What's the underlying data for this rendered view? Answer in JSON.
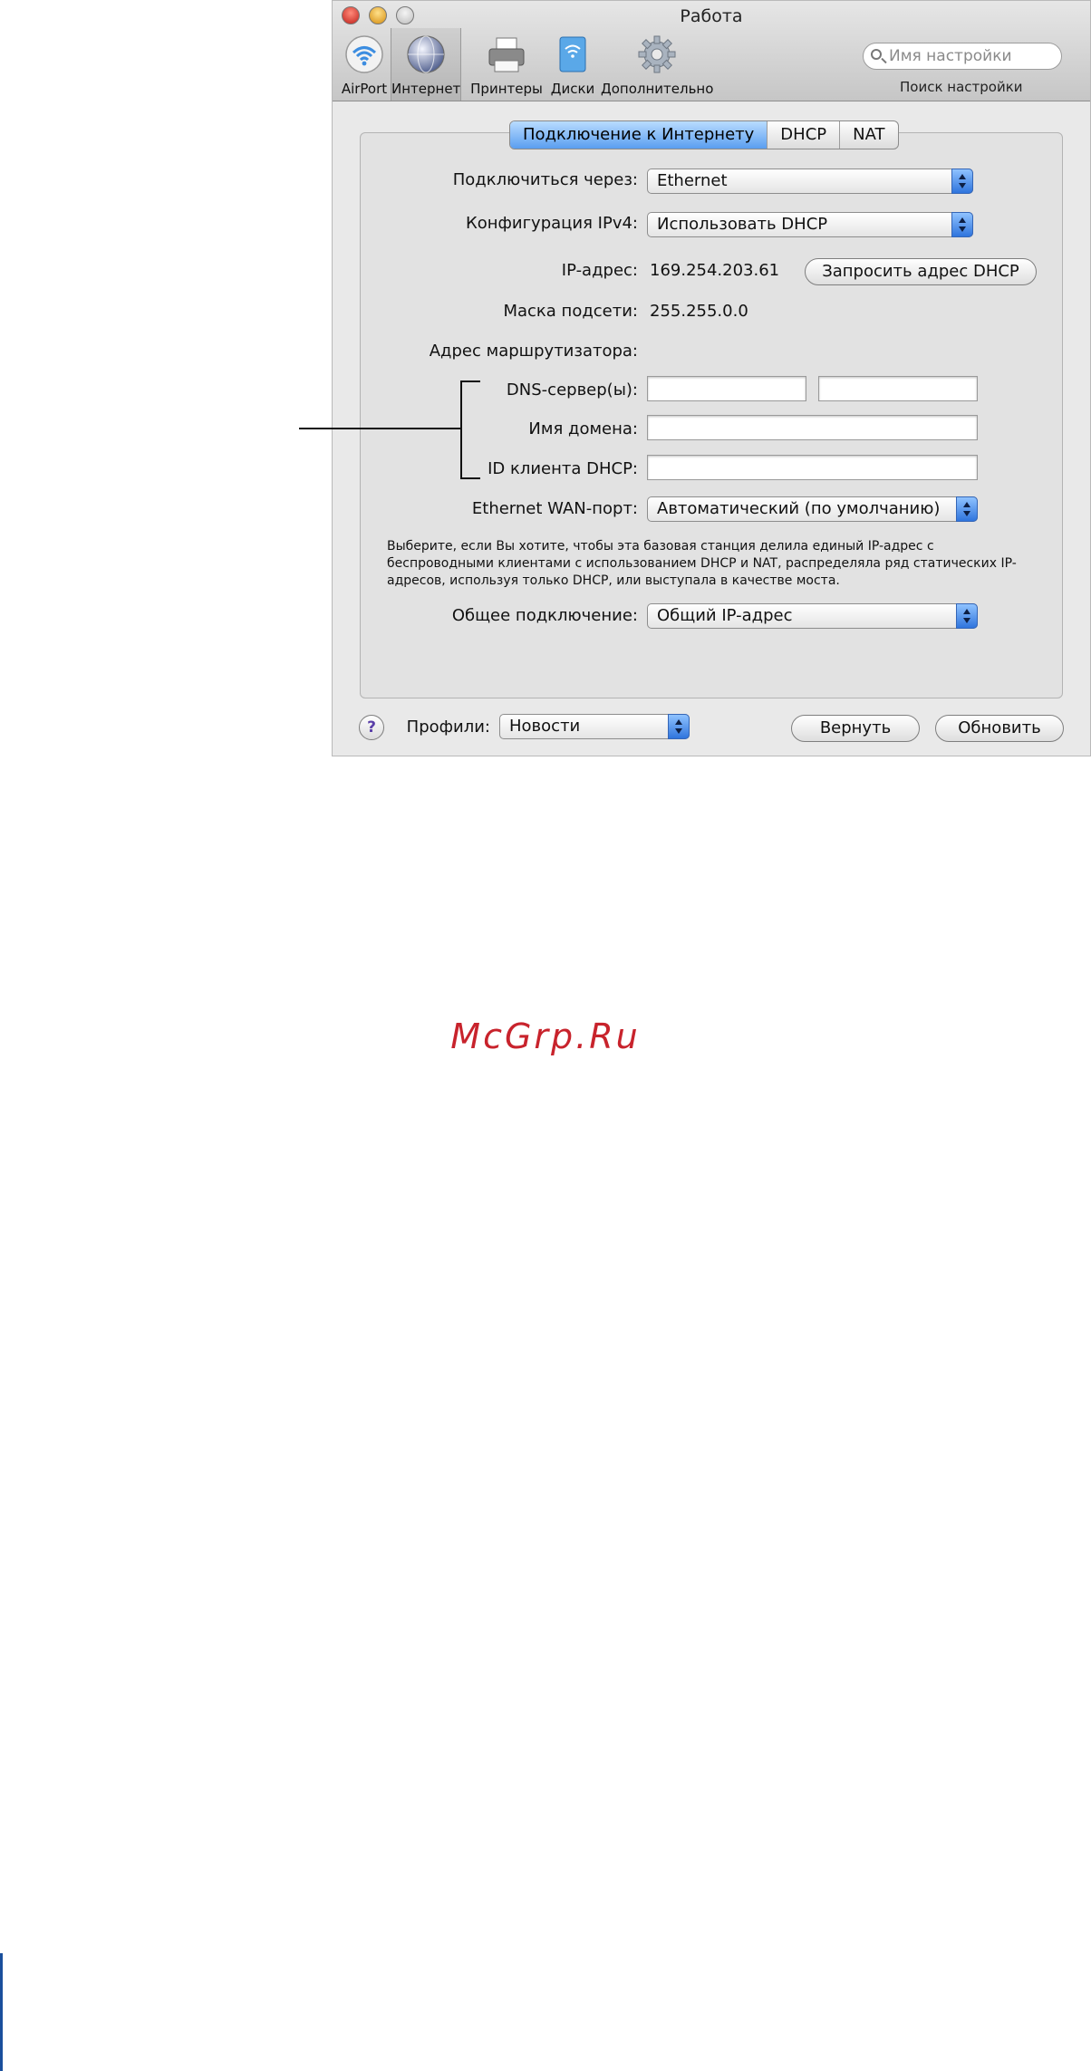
{
  "window": {
    "title": "Работа"
  },
  "toolbar": {
    "items": [
      {
        "label": "AirPort",
        "icon": "airport-icon"
      },
      {
        "label": "Интернет",
        "icon": "internet-globe-icon"
      },
      {
        "label": "Принтеры",
        "icon": "printer-icon"
      },
      {
        "label": "Диски",
        "icon": "disk-icon"
      },
      {
        "label": "Дополнительно",
        "icon": "gear-icon"
      }
    ],
    "selected": "Интернет",
    "search_placeholder": "Имя настройки",
    "search_caption": "Поиск настройки"
  },
  "tabs": [
    {
      "label": "Подключение к Интернету",
      "active": true
    },
    {
      "label": "DHCP",
      "active": false
    },
    {
      "label": "NAT",
      "active": false
    }
  ],
  "form": {
    "connect_via_label": "Подключиться через:",
    "connect_via_value": "Ethernet",
    "ipv4_label": "Конфигурация IPv4:",
    "ipv4_value": "Использовать DHCP",
    "ip_label": "IP-адрес:",
    "ip_value": "169.254.203.61",
    "renew_dhcp_button": "Запросить адрес DHCP",
    "mask_label": "Маска подсети:",
    "mask_value": "255.255.0.0",
    "router_label": "Адрес маршрутизатора:",
    "dns_label": "DNS-сервер(ы):",
    "dns_value_1": "",
    "dns_value_2": "",
    "domain_label": "Имя домена:",
    "domain_value": "",
    "dhcp_client_label": "ID клиента DHCP:",
    "dhcp_client_value": "",
    "wan_label": "Ethernet WAN-порт:",
    "wan_value": "Автоматический (по умолчанию)",
    "description": "Выберите, если Вы хотите, чтобы эта базовая станция делила единый IP-адрес с беспроводными клиентами с использованием DHCP и NAT, распределяла ряд статических IP-адресов, используя только DHCP, или выступала в качестве моста.",
    "sharing_label": "Общее подключение:",
    "sharing_value": "Общий IP-адрес"
  },
  "footer": {
    "help": "?",
    "profiles_label": "Профили:",
    "profiles_value": "Новости",
    "revert_button": "Вернуть",
    "update_button": "Обновить"
  },
  "watermark": "McGrp.Ru",
  "colors": {
    "accent_blue": "#3a86ee",
    "watermark_red": "#c8232c"
  }
}
